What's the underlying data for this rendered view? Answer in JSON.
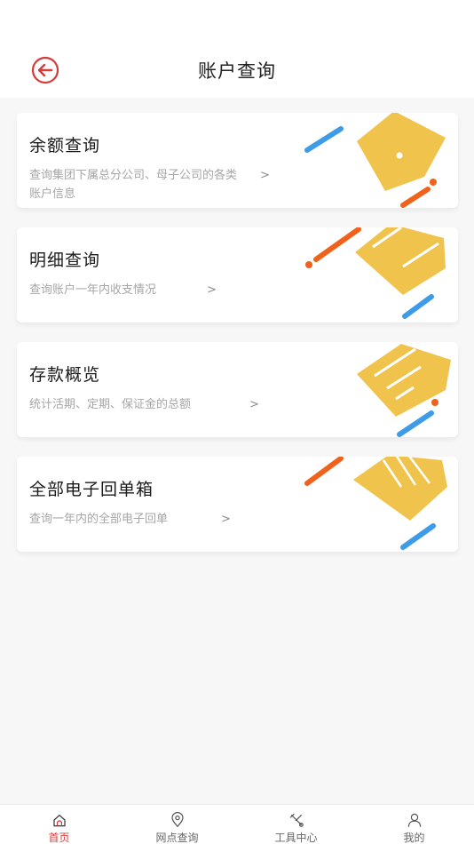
{
  "header": {
    "title": "账户查询"
  },
  "cards": [
    {
      "title": "余额查询",
      "desc": "查询集团下属总分公司、母子公司的各类账户信息",
      "arrow": ">"
    },
    {
      "title": "明细查询",
      "desc": "查询账户一年内收支情况",
      "arrow": ">"
    },
    {
      "title": "存款概览",
      "desc": "统计活期、定期、保证金的总额",
      "arrow": ">"
    },
    {
      "title": "全部电子回单箱",
      "desc": "查询一年内的全部电子回单",
      "arrow": ">"
    }
  ],
  "tabbar": {
    "items": [
      {
        "icon": "home-icon",
        "label": "首页",
        "active": true
      },
      {
        "icon": "location-icon",
        "label": "网点查询"
      },
      {
        "icon": "tools-icon",
        "label": "工具中心"
      },
      {
        "icon": "user-icon",
        "label": "我的"
      }
    ]
  },
  "colors": {
    "accent_red": "#d43c3c",
    "illus_yellow": "#f0c44c",
    "illus_blue": "#3d9be8",
    "illus_orange": "#f0621c"
  }
}
